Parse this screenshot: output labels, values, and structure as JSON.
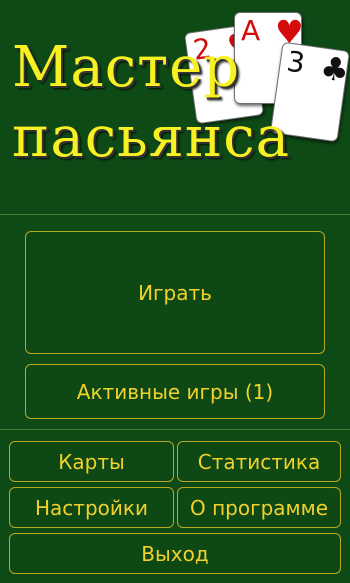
{
  "header": {
    "title_line1": "Мастер",
    "title_line2": "пасьянса",
    "cards": [
      {
        "rank": "2",
        "suit": "♥",
        "color": "red"
      },
      {
        "rank": "A",
        "suit": "♥",
        "color": "red"
      },
      {
        "rank": "3",
        "suit": "♣",
        "color": "black"
      }
    ]
  },
  "menu": {
    "play": "Играть",
    "active_games": "Активные игры (1)",
    "cards": "Карты",
    "statistics": "Статистика",
    "settings": "Настройки",
    "about": "О программе",
    "exit": "Выход"
  },
  "colors": {
    "background": "#0e4a16",
    "accent": "#f2d22a",
    "border": "#b9a826"
  }
}
